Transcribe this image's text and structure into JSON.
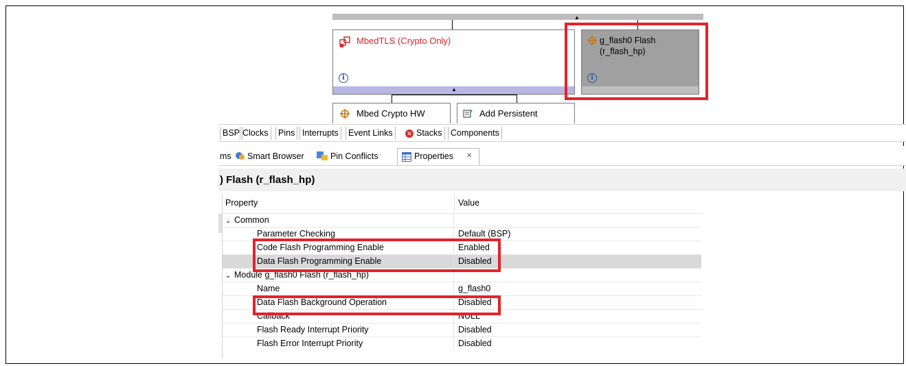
{
  "stack": {
    "mbedtls_title": "MbedTLS (Crypto Only)",
    "flash_title_line1": "g_flash0 Flash",
    "flash_title_line2": "(r_flash_hp)",
    "crypto_hw_title": "Mbed Crypto HW",
    "add_persistent_title": "Add Persistent",
    "info_glyph": "i",
    "colors": {
      "selected_box": "#a0a0a0",
      "purple_bar": "#b8b6e6",
      "error_title": "#e32229"
    }
  },
  "editor_tabs": [
    "BSP",
    "Clocks",
    "Pins",
    "Interrupts",
    "Event Links",
    "Stacks",
    "Components"
  ],
  "view_tabs": {
    "partial": "ms",
    "smart_browser": "Smart Browser",
    "pin_conflicts": "Pin Conflicts",
    "properties": "Properties",
    "close_glyph": "✕"
  },
  "panel_title": ") Flash (r_flash_hp)",
  "table": {
    "header_property": "Property",
    "header_value": "Value",
    "rows": [
      {
        "label": "Common",
        "value": "",
        "group": true
      },
      {
        "label": "Parameter Checking",
        "value": "Default (BSP)"
      },
      {
        "label": "Code Flash Programming Enable",
        "value": "Enabled"
      },
      {
        "label": "Data Flash Programming Enable",
        "value": "Disabled",
        "selected": true
      },
      {
        "label": "Module g_flash0 Flash (r_flash_hp)",
        "value": "",
        "group": true
      },
      {
        "label": "Name",
        "value": "g_flash0"
      },
      {
        "label": "Data Flash Background Operation",
        "value": "Disabled"
      },
      {
        "label": "Callback",
        "value": "NULL"
      },
      {
        "label": "Flash Ready Interrupt Priority",
        "value": "Disabled"
      },
      {
        "label": "Flash Error Interrupt Priority",
        "value": "Disabled"
      }
    ]
  },
  "highlight_color": "#e32229"
}
